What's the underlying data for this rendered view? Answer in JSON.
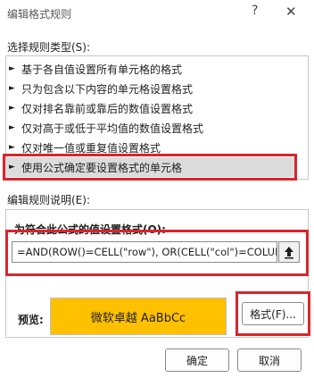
{
  "window": {
    "title": "编辑格式规则",
    "help_glyph": "?",
    "close_glyph": "✕"
  },
  "rule_type": {
    "label": "选择规则类型(S):",
    "items": [
      {
        "label": "基于各自值设置所有单元格的格式",
        "selected": false
      },
      {
        "label": "只为包含以下内容的单元格设置格式",
        "selected": false
      },
      {
        "label": "仅对排名靠前或靠后的数值设置格式",
        "selected": false
      },
      {
        "label": "仅对高于或低于平均值的数值设置格式",
        "selected": false
      },
      {
        "label": "仅对唯一值或重复值设置格式",
        "selected": false
      },
      {
        "label": "使用公式确定要设置格式的单元格",
        "selected": true
      }
    ],
    "arrow_glyph": "►"
  },
  "edit_rule": {
    "label": "编辑规则说明(E):",
    "formula_label": "为符合此公式的值设置格式(O):",
    "formula_value": "=AND(ROW()=CELL(\"row\"), OR(CELL(\"col\")=COLUMN",
    "collapse_icon": "arrow-up-icon"
  },
  "preview": {
    "label": "预览:",
    "sample_text": "微软卓越  AaBbCc",
    "fill_color": "#ffc000"
  },
  "buttons": {
    "format": "格式(F)...",
    "ok": "确定",
    "cancel": "取消"
  },
  "colors": {
    "highlight": "#d9252d"
  }
}
